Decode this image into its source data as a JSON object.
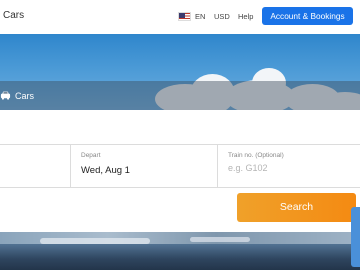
{
  "header": {
    "nav_cars": "Cars",
    "flag_icon": "us-flag-icon",
    "language": "EN",
    "currency": "USD",
    "help": "Help",
    "account_button": "Account & Bookings"
  },
  "hero": {
    "tab_icon": "car-icon",
    "tab_label": "Cars"
  },
  "form": {
    "depart_label": "Depart",
    "depart_value": "Wed, Aug 1",
    "train_label": "Train no. (Optional)",
    "train_placeholder": "e.g. G102",
    "train_value": ""
  },
  "search_button": "Search",
  "colors": {
    "accent_blue": "#1a73e8",
    "search_orange": "#f48a12"
  }
}
